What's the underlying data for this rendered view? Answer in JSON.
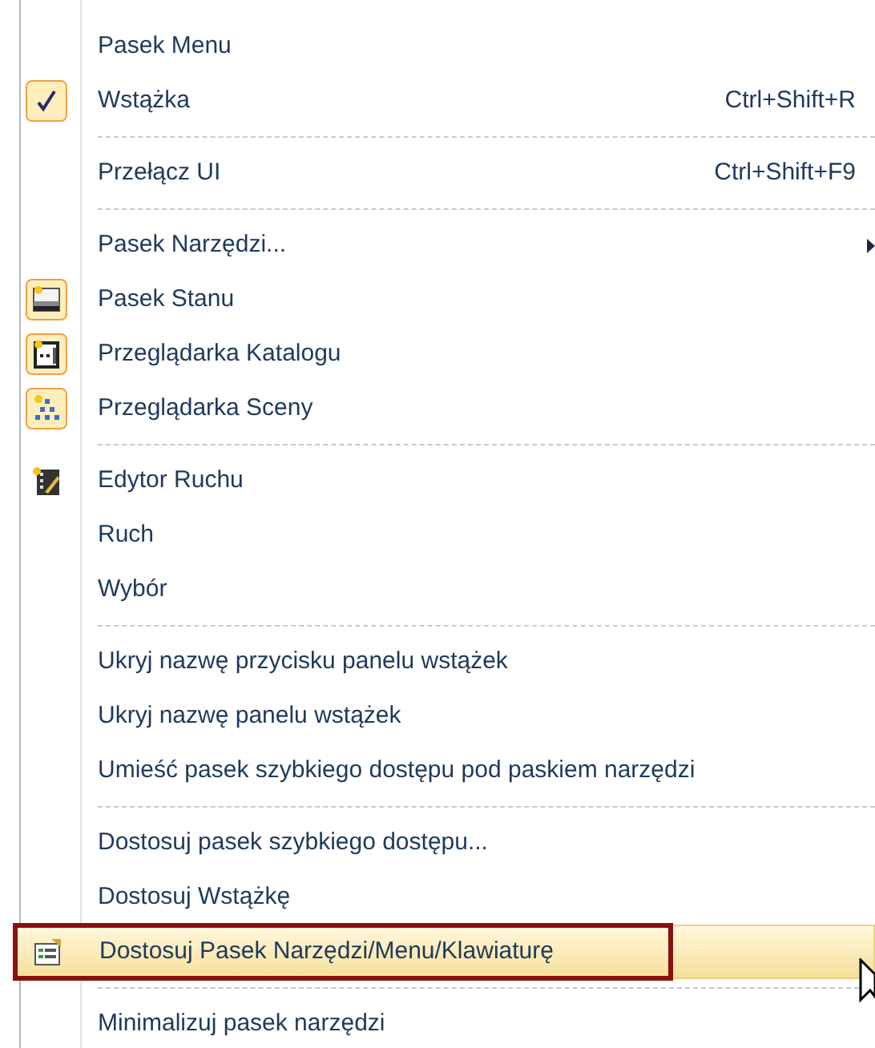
{
  "menu": {
    "items": [
      {
        "kind": "item",
        "label": "Pasek Menu",
        "checked": false,
        "selected": false
      },
      {
        "kind": "item",
        "label": "Wstążka",
        "checked": true,
        "selected": false,
        "shortcut": "Ctrl+Shift+R"
      },
      {
        "kind": "separator"
      },
      {
        "kind": "item",
        "label": "Przełącz UI",
        "checked": false,
        "selected": false,
        "shortcut": "Ctrl+Shift+F9"
      },
      {
        "kind": "separator"
      },
      {
        "kind": "item",
        "label": "Pasek Narzędzi...",
        "checked": false,
        "selected": false,
        "submenu": true
      },
      {
        "kind": "item",
        "label": "Pasek Stanu",
        "checked": true,
        "selected": false
      },
      {
        "kind": "item",
        "label": "Przeglądarka Katalogu",
        "checked": true,
        "selected": false
      },
      {
        "kind": "item",
        "label": "Przeglądarka Sceny",
        "checked": true,
        "selected": false
      },
      {
        "kind": "separator"
      },
      {
        "kind": "item",
        "label": "Edytor Ruchu",
        "checked": false,
        "selected": false
      },
      {
        "kind": "item",
        "label": "Ruch",
        "checked": false,
        "selected": false
      },
      {
        "kind": "item",
        "label": "Wybór",
        "checked": false,
        "selected": false
      },
      {
        "kind": "separator"
      },
      {
        "kind": "item",
        "label": "Ukryj nazwę przycisku panelu wstążek",
        "checked": false,
        "selected": false
      },
      {
        "kind": "item",
        "label": "Ukryj nazwę panelu wstążek",
        "checked": false,
        "selected": false
      },
      {
        "kind": "item",
        "label": "Umieść pasek szybkiego dostępu pod paskiem narzędzi",
        "checked": false,
        "selected": false
      },
      {
        "kind": "separator"
      },
      {
        "kind": "item",
        "label": "Dostosuj pasek szybkiego dostępu...",
        "checked": false,
        "selected": false
      },
      {
        "kind": "item",
        "label": "Dostosuj Wstążkę",
        "checked": false,
        "selected": false
      },
      {
        "kind": "item",
        "label": "Dostosuj Pasek Narzędzi/Menu/Klawiaturę",
        "checked": false,
        "selected": true,
        "outlined": true
      },
      {
        "kind": "separator"
      },
      {
        "kind": "item",
        "label": "Minimalizuj pasek narzędzi",
        "checked": false,
        "selected": false
      }
    ]
  }
}
